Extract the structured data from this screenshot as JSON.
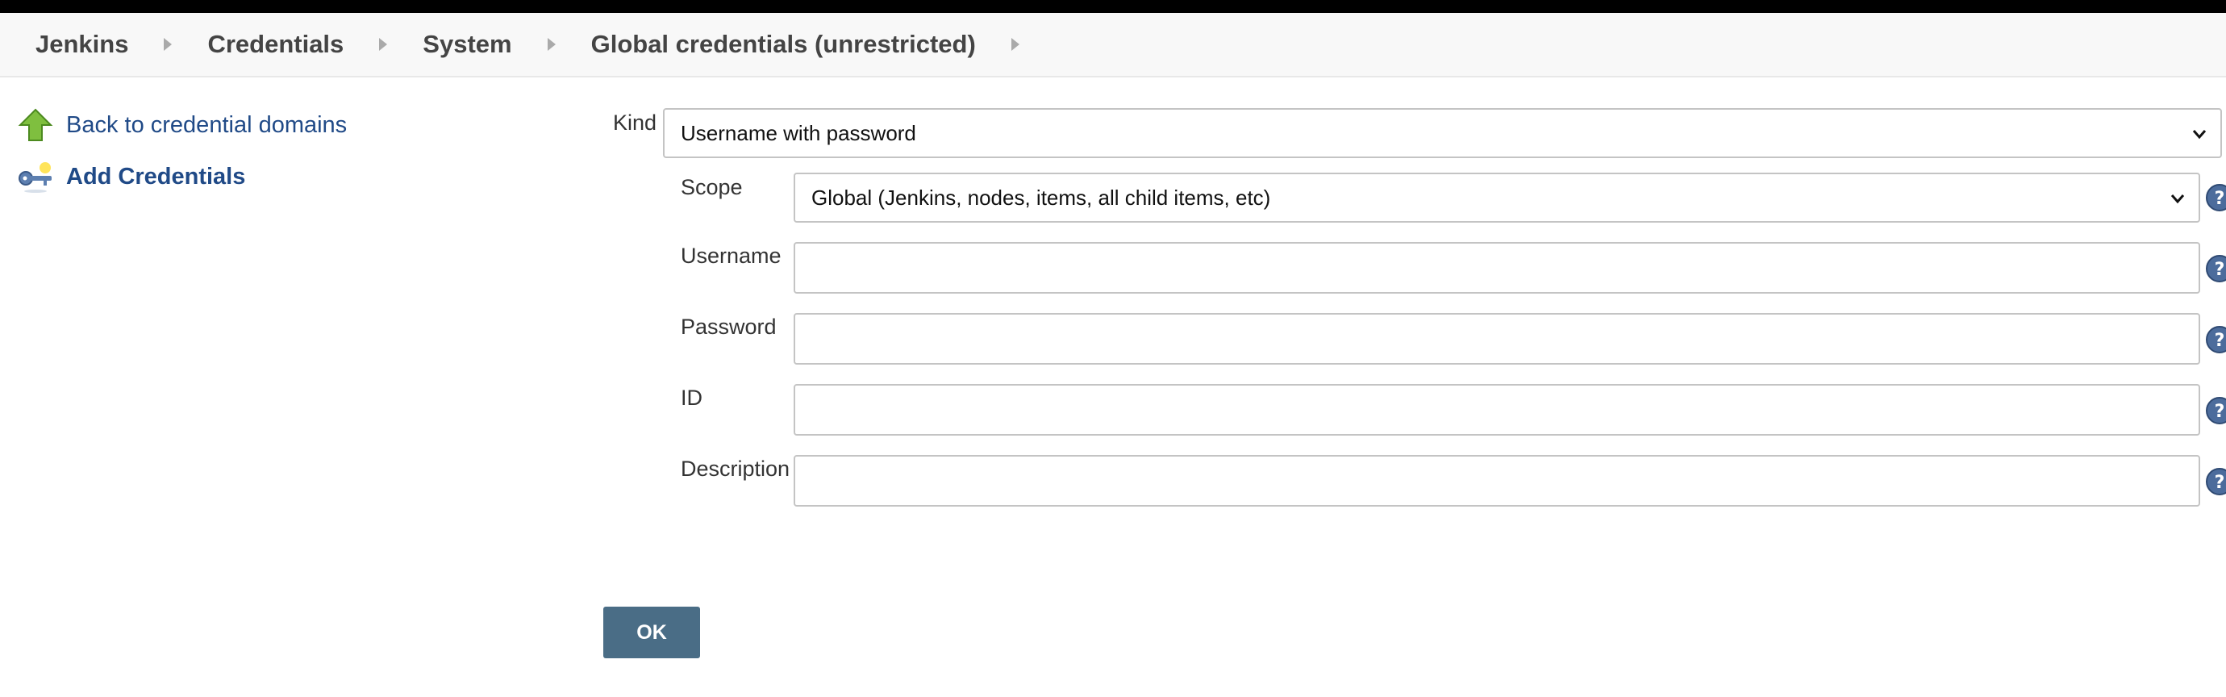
{
  "breadcrumbs": [
    "Jenkins",
    "Credentials",
    "System",
    "Global credentials (unrestricted)"
  ],
  "sidebar": {
    "items": [
      {
        "label": "Back to credential domains",
        "icon": "up-arrow-icon"
      },
      {
        "label": "Add Credentials",
        "icon": "key-icon"
      }
    ]
  },
  "form": {
    "kind": {
      "label": "Kind",
      "value": "Username with password"
    },
    "scope": {
      "label": "Scope",
      "value": "Global (Jenkins, nodes, items, all child items, etc)"
    },
    "username": {
      "label": "Username",
      "value": ""
    },
    "password": {
      "label": "Password",
      "value": ""
    },
    "id": {
      "label": "ID",
      "value": ""
    },
    "description": {
      "label": "Description",
      "value": ""
    }
  },
  "ok_label": "OK",
  "colors": {
    "link": "#204a87",
    "button": "#4a6d86",
    "help": "#4c6c9c"
  }
}
